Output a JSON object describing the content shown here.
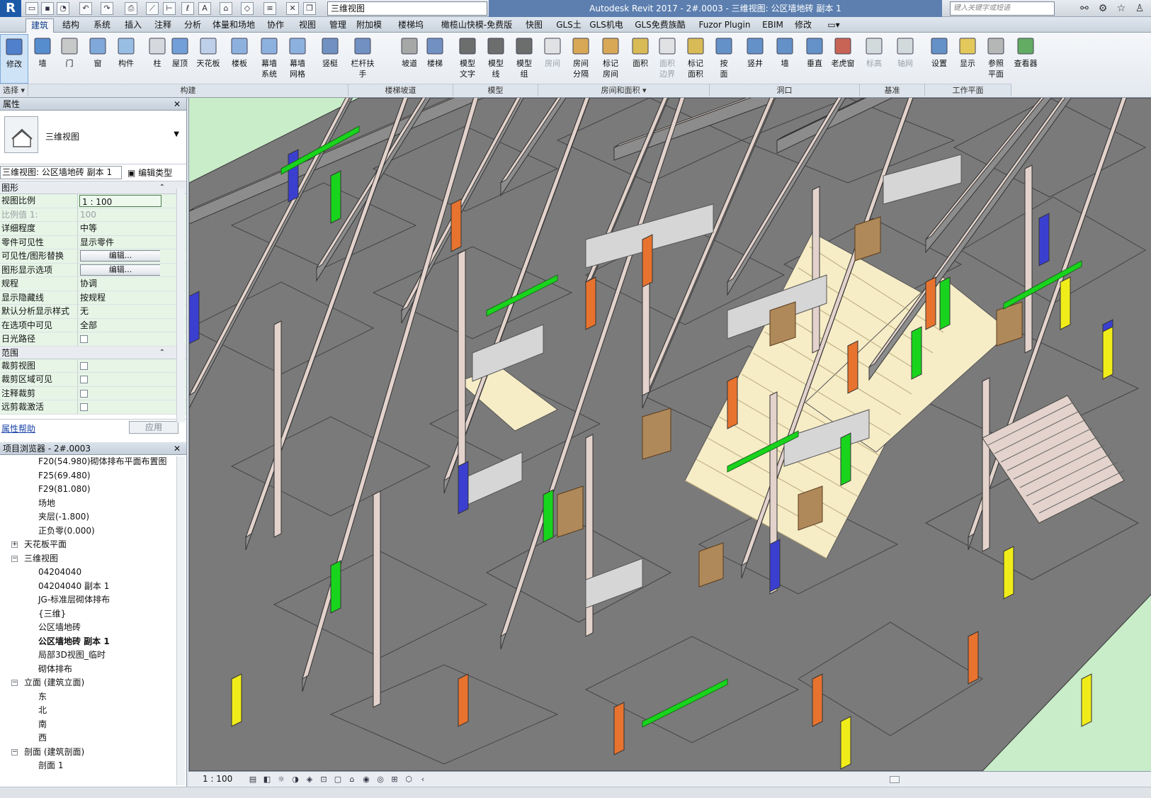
{
  "qat": {
    "view_selector": "三维视图",
    "title": "Autodesk Revit 2017 -     2#.0003 - 三维视图: 公区墙地砖 副本 1",
    "search_placeholder": "键入关键字或短语",
    "logo": "R"
  },
  "tabs": [
    "建筑",
    "结构",
    "系统",
    "插入",
    "注释",
    "分析",
    "体量和场地",
    "协作",
    "视图",
    "管理",
    "附加模块",
    "楼梯坞",
    "橄榄山快模-免费版",
    "快图",
    "GLS土建",
    "GLS机电",
    "GLS免费族酷",
    "Fuzor Plugin",
    "EBIM",
    "修改"
  ],
  "ribbon": {
    "buttons": [
      {
        "label": "修改",
        "icon": "modify-icon"
      },
      {
        "label": "墙",
        "icon": "wall-icon"
      },
      {
        "label": "门",
        "icon": "door-icon"
      },
      {
        "label": "窗",
        "icon": "window-icon"
      },
      {
        "label": "构件",
        "icon": "component-icon"
      },
      {
        "label": "柱",
        "icon": "column-icon"
      },
      {
        "label": "屋顶",
        "icon": "roof-icon"
      },
      {
        "label": "天花板",
        "icon": "ceiling-icon"
      },
      {
        "label": "楼板",
        "icon": "floor-icon"
      },
      {
        "label": "幕墙\n系统",
        "icon": "curtain-system-icon"
      },
      {
        "label": "幕墙\n网格",
        "icon": "curtain-grid-icon"
      },
      {
        "label": "竖梃",
        "icon": "mullion-icon"
      },
      {
        "label": "栏杆扶手",
        "icon": "railing-icon"
      },
      {
        "label": "坡道",
        "icon": "ramp-icon"
      },
      {
        "label": "楼梯",
        "icon": "stair-icon"
      },
      {
        "label": "模型\n文字",
        "icon": "model-text-icon"
      },
      {
        "label": "模型\n线",
        "icon": "model-line-icon"
      },
      {
        "label": "模型\n组",
        "icon": "model-group-icon"
      },
      {
        "label": "房间",
        "icon": "room-icon"
      },
      {
        "label": "房间\n分隔",
        "icon": "room-separator-icon"
      },
      {
        "label": "标记\n房间",
        "icon": "tag-room-icon"
      },
      {
        "label": "面积",
        "icon": "area-icon"
      },
      {
        "label": "面积\n边界",
        "icon": "area-boundary-icon"
      },
      {
        "label": "标记\n面积",
        "icon": "tag-area-icon"
      },
      {
        "label": "按\n面",
        "icon": "by-face-icon"
      },
      {
        "label": "竖井",
        "icon": "shaft-icon"
      },
      {
        "label": "墙",
        "icon": "wall-opening-icon"
      },
      {
        "label": "垂直",
        "icon": "vertical-opening-icon"
      },
      {
        "label": "老虎窗",
        "icon": "dormer-icon"
      },
      {
        "label": "标高",
        "icon": "level-icon"
      },
      {
        "label": "轴网",
        "icon": "grid-icon"
      },
      {
        "label": "设置",
        "icon": "set-workplane-icon"
      },
      {
        "label": "显示",
        "icon": "show-workplane-icon"
      },
      {
        "label": "参照\n平面",
        "icon": "ref-plane-icon"
      },
      {
        "label": "查看器",
        "icon": "viewer-icon"
      }
    ],
    "groups": [
      "选择 ▾",
      "构建",
      "楼梯坡道",
      "模型",
      "房间和面积 ▾",
      "洞口",
      "基准",
      "工作平面"
    ]
  },
  "properties": {
    "title": "属性",
    "close": "✕",
    "type_name": "三维视图",
    "instance": "三维视图: 公区墙地砖 副本 1",
    "edit_type": "编辑类型",
    "section_graphics": "图形",
    "section_extents": "范围",
    "rows": [
      {
        "k": "视图比例",
        "v": "1 : 100"
      },
      {
        "k": "比例值 1:",
        "v": "100"
      },
      {
        "k": "详细程度",
        "v": "中等"
      },
      {
        "k": "零件可见性",
        "v": "显示零件"
      },
      {
        "k": "可见性/图形替换",
        "v": "编辑..."
      },
      {
        "k": "图形显示选项",
        "v": "编辑..."
      },
      {
        "k": "规程",
        "v": "协调"
      },
      {
        "k": "显示隐藏线",
        "v": "按规程"
      },
      {
        "k": "默认分析显示样式",
        "v": "无"
      },
      {
        "k": "在选项中可见",
        "v": "全部"
      },
      {
        "k": "日光路径",
        "v": ""
      }
    ],
    "extent_rows": [
      {
        "k": "裁剪视图",
        "v": ""
      },
      {
        "k": "裁剪区域可见",
        "v": ""
      },
      {
        "k": "注释裁剪",
        "v": ""
      },
      {
        "k": "远剪裁激活",
        "v": ""
      }
    ],
    "help": "属性帮助",
    "apply": "应用"
  },
  "browser": {
    "title": "项目浏览器 - 2#.0003",
    "close": "✕",
    "items": [
      {
        "label": "F20(54.980)砌体排布平面布置图",
        "indent": 3,
        "toggle": ""
      },
      {
        "label": "F25(69.480)",
        "indent": 3,
        "toggle": ""
      },
      {
        "label": "F29(81.080)",
        "indent": 3,
        "toggle": ""
      },
      {
        "label": "场地",
        "indent": 3,
        "toggle": ""
      },
      {
        "label": "夹层(-1.800)",
        "indent": 3,
        "toggle": ""
      },
      {
        "label": "正负零(0.000)",
        "indent": 3,
        "toggle": ""
      },
      {
        "label": "天花板平面",
        "indent": 2,
        "toggle": "+"
      },
      {
        "label": "三维视图",
        "indent": 2,
        "toggle": "−"
      },
      {
        "label": "04204040",
        "indent": 3,
        "toggle": ""
      },
      {
        "label": "04204040 副本 1",
        "indent": 3,
        "toggle": ""
      },
      {
        "label": "JG-标准层砌体排布",
        "indent": 3,
        "toggle": ""
      },
      {
        "label": "{三维}",
        "indent": 3,
        "toggle": ""
      },
      {
        "label": "公区墙地砖",
        "indent": 3,
        "toggle": ""
      },
      {
        "label": "公区墙地砖 副本 1",
        "indent": 3,
        "toggle": "",
        "bold": true
      },
      {
        "label": "局部3D视图_临时",
        "indent": 3,
        "toggle": ""
      },
      {
        "label": "砌体排布",
        "indent": 3,
        "toggle": ""
      },
      {
        "label": "立面 (建筑立面)",
        "indent": 1,
        "toggle": "−"
      },
      {
        "label": "东",
        "indent": 3,
        "toggle": ""
      },
      {
        "label": "北",
        "indent": 3,
        "toggle": ""
      },
      {
        "label": "南",
        "indent": 3,
        "toggle": ""
      },
      {
        "label": "西",
        "indent": 3,
        "toggle": ""
      },
      {
        "label": "剖面 (建筑剖面)",
        "indent": 1,
        "toggle": "−"
      },
      {
        "label": "剖面 1",
        "indent": 3,
        "toggle": ""
      }
    ]
  },
  "viewport": {
    "scale": "1 : 100",
    "colors": {
      "background": "#c9ecc9",
      "wall_top": "#e3d3cc",
      "wall_side": "#8c8c8c",
      "slab": "#7a7a7a",
      "accent_orange": "#e8732e",
      "accent_green": "#19d41c",
      "accent_yellow": "#f0ec1a",
      "accent_blue": "#3b3fd0",
      "tile": "#f6ecc6",
      "brick": "#d6d6d6",
      "door": "#b0895a"
    }
  }
}
